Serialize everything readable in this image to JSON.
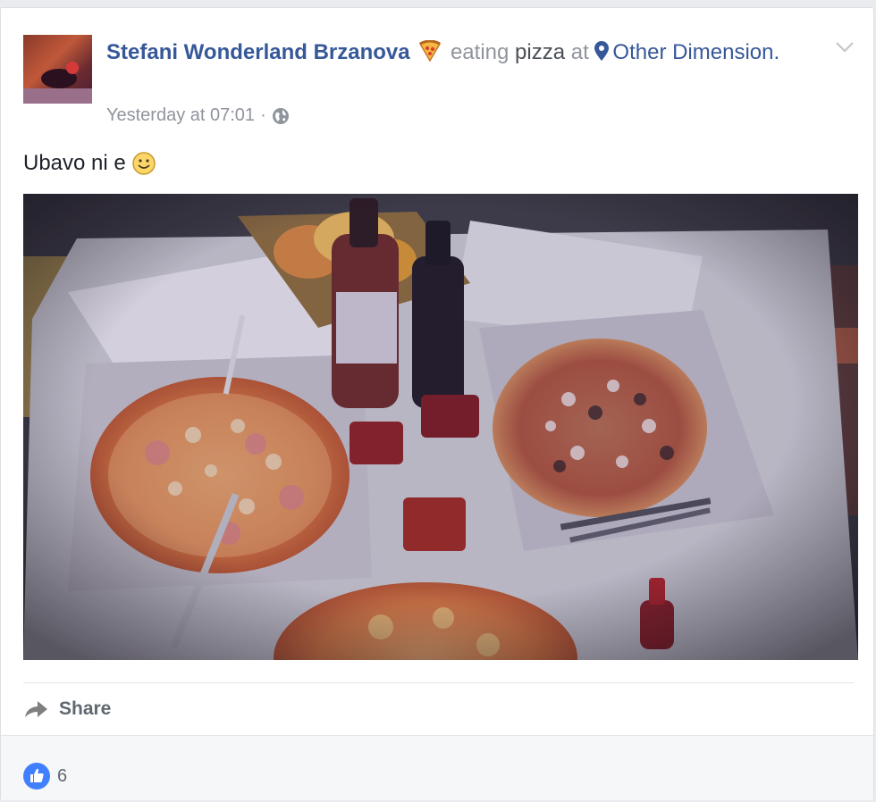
{
  "post": {
    "author": "Stefani Wonderland Brzanova",
    "activity_icon": "pizza-icon",
    "activity_verb": "eating",
    "activity_object": "pizza",
    "at_word": "at",
    "place_icon": "map-pin-icon",
    "place": "Other Dimension",
    "place_end": ".",
    "timestamp": "Yesterday at 07:01",
    "separator": "·",
    "privacy_icon": "globe-icon",
    "text": "Ubavo ni e",
    "text_emoji": "smile-icon",
    "photo_description_icon": "photo"
  },
  "actions": {
    "share_label": "Share",
    "share_icon": "share-arrow-icon"
  },
  "reactions": {
    "icon": "like-thumb-icon",
    "count": "6"
  },
  "colors": {
    "link": "#365899",
    "meta": "#90949c",
    "like_blue": "#4080ff",
    "background": "#e9ebee"
  }
}
